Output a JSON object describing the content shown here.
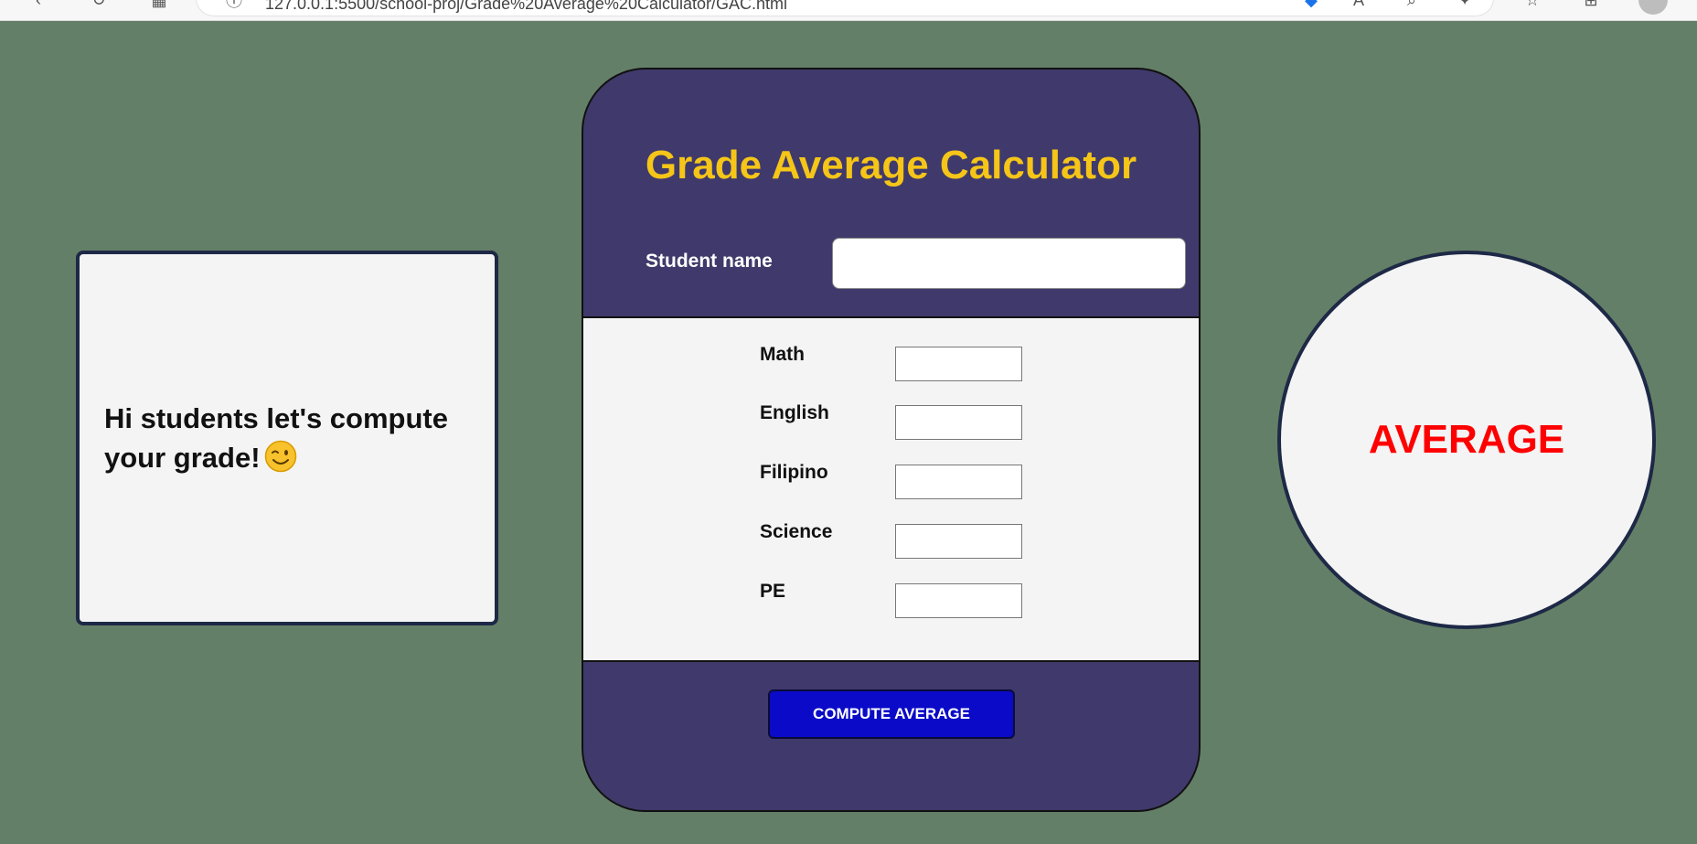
{
  "browser": {
    "url": "127.0.0.1:5500/school-proj/Grade%20Average%20Calculator/GAC.html",
    "icons": [
      "back-icon",
      "refresh-icon",
      "apps-icon",
      "site-info-icon",
      "shield-icon",
      "read-aloud-icon",
      "zoom-icon",
      "extensions-icon",
      "favorites-icon",
      "collections-icon",
      "profile-icon"
    ]
  },
  "greeting": {
    "text": "Hi students let's compute your grade!"
  },
  "calculator": {
    "title": "Grade Average Calculator",
    "student_name_label": "Student name",
    "student_name_value": "",
    "subjects": [
      {
        "label": "Math",
        "value": ""
      },
      {
        "label": "English",
        "value": ""
      },
      {
        "label": "Filipino",
        "value": ""
      },
      {
        "label": "Science",
        "value": ""
      },
      {
        "label": "PE",
        "value": ""
      }
    ],
    "compute_button": "COMPUTE AVERAGE"
  },
  "result": {
    "label": "AVERAGE"
  },
  "colors": {
    "background": "#647f67",
    "panel": "#3f3a6b",
    "title": "#f5c518",
    "button": "#0a0ac8",
    "average_text": "#ff0000"
  }
}
